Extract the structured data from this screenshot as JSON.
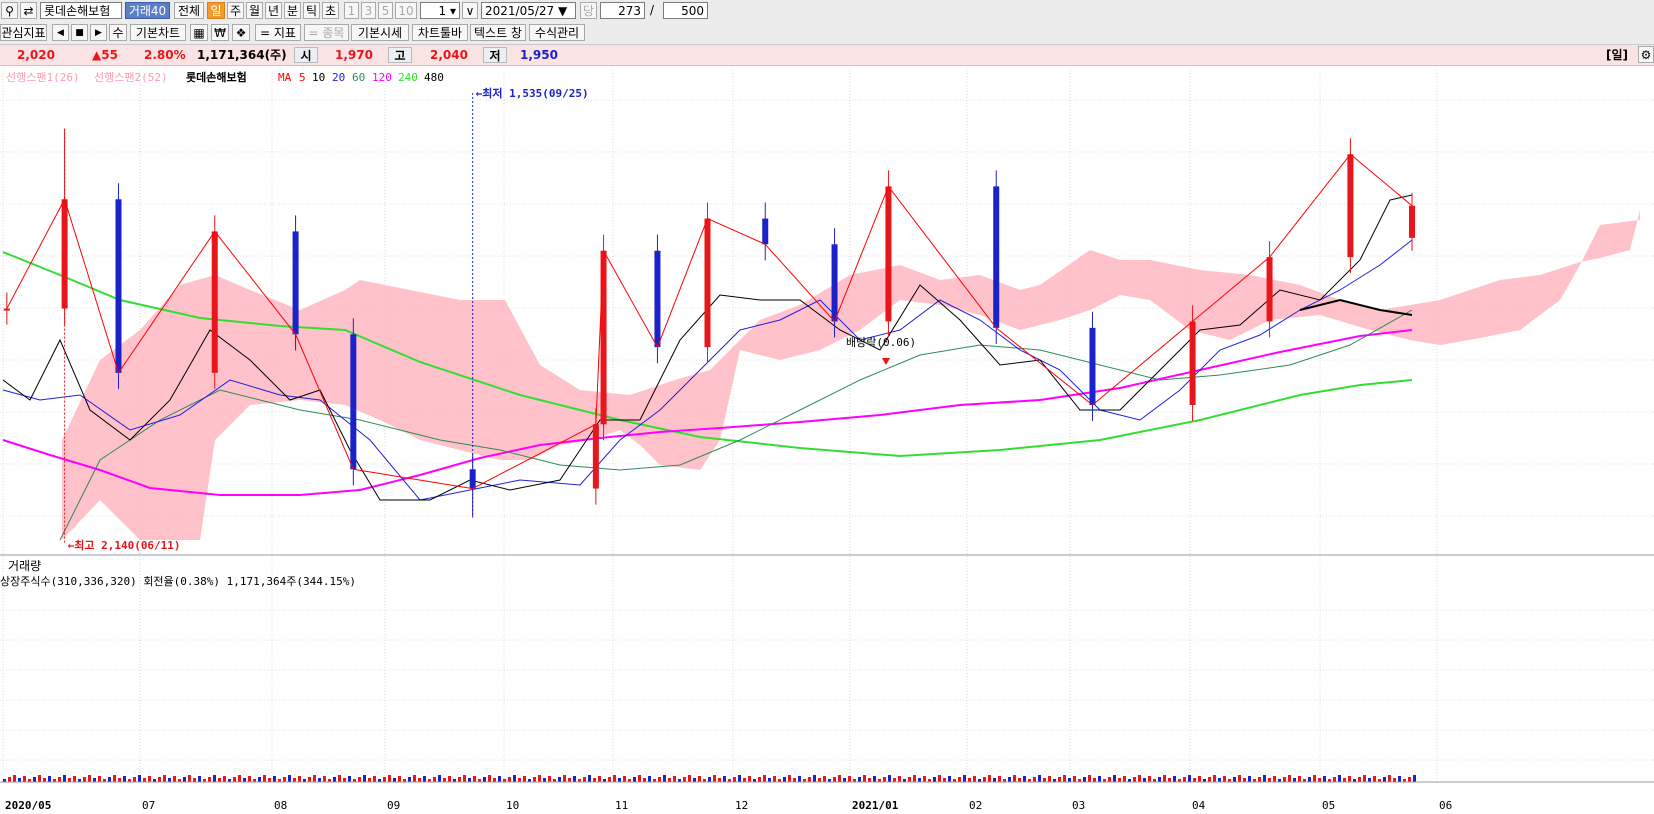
{
  "toolbar": {
    "stock_name": "롯데손해보험",
    "badge": "거래40",
    "periods": [
      "전체",
      "일",
      "주",
      "월",
      "년",
      "분",
      "틱",
      "초"
    ],
    "period_nums": [
      "1",
      "3",
      "5",
      "10"
    ],
    "unit_value": "1",
    "date": "2021/05/27",
    "date_btn": "당",
    "count_value": "273",
    "slash": "/",
    "total_value": "500"
  },
  "toolbar2": {
    "interest_label": "관심지표",
    "prev": "◀",
    "stop": "■",
    "next": "▶",
    "edit": "수",
    "basic_chart": "기본차트",
    "indicator": "지표",
    "item": "종목",
    "basic_quote": "기본시세",
    "chart_toolbar": "차트툴바",
    "text_label": "텍스트 창",
    "formula": "수식관리"
  },
  "quote": {
    "price": "2,020",
    "change": "▲55",
    "rate": "2.80%",
    "volume": "1,171,364(주)",
    "open_label": "시",
    "open": "1,970",
    "high_label": "고",
    "high": "2,040",
    "low_label": "저",
    "low": "1,950",
    "period_tag": "[일]"
  },
  "legend": {
    "span1": "선행스팬1(26)",
    "span2": "선행스팬2(52)",
    "name": "롯데손해보험",
    "ma_label": "MA",
    "periods": [
      "5",
      "10",
      "20",
      "60",
      "120",
      "240",
      "480"
    ],
    "colors": [
      "#ff0000",
      "#000000",
      "#2020e0",
      "#2e8b57",
      "#ff00ff",
      "#33dd33",
      "#000000"
    ]
  },
  "annotations": {
    "low": "최저 1,535(09/25)",
    "high": "최고 2,140(06/11)",
    "dividend": "배당락(0.06)"
  },
  "volume_panel": {
    "title": "거래량",
    "info": "상장주식수(310,336,320) 회전율(0.38%) 1,171,364주(344.15%)"
  },
  "x_axis": {
    "labels": [
      "2020/05",
      "07",
      "08",
      "09",
      "10",
      "11",
      "12",
      "2021/01",
      "02",
      "03",
      "04",
      "05",
      "06"
    ]
  },
  "colors": {
    "up": "#e8151b",
    "down": "#1a22c9",
    "cloud": "#ffb6c1",
    "ma5": "#ff0000",
    "ma10": "#000000",
    "ma20": "#2020e0",
    "ma60": "#2e8b57",
    "ma120": "#ff00ff",
    "ma240": "#33dd33"
  },
  "chart_data": {
    "type": "candlestick",
    "title": "롯데손해보험",
    "period": "daily",
    "x_range": [
      "2020/05",
      "2021/06"
    ],
    "y_range": [
      1500,
      2200
    ],
    "grid": true,
    "points": [
      {
        "date": "2020-05-27",
        "close": 1860
      },
      {
        "date": "2020-06-11",
        "close": 2030,
        "high": 2140
      },
      {
        "date": "2020-06-25",
        "close": 1760
      },
      {
        "date": "2020-07-20",
        "close": 1980
      },
      {
        "date": "2020-08-10",
        "close": 1820
      },
      {
        "date": "2020-08-25",
        "close": 1610
      },
      {
        "date": "2020-09-25",
        "close": 1580,
        "low": 1535
      },
      {
        "date": "2020-10-27",
        "close": 1680
      },
      {
        "date": "2020-10-29",
        "close": 1950
      },
      {
        "date": "2020-11-12",
        "close": 1800
      },
      {
        "date": "2020-11-25",
        "close": 2000
      },
      {
        "date": "2020-12-10",
        "close": 1960
      },
      {
        "date": "2020-12-28",
        "close": 1840
      },
      {
        "date": "2021-01-11",
        "close": 2050
      },
      {
        "date": "2021-02-08",
        "close": 1830
      },
      {
        "date": "2021-03-05",
        "close": 1710
      },
      {
        "date": "2021-03-31",
        "close": 1840
      },
      {
        "date": "2021-04-20",
        "close": 1940
      },
      {
        "date": "2021-05-11",
        "close": 2100
      },
      {
        "date": "2021-05-27",
        "open": 1970,
        "high": 2040,
        "low": 1950,
        "close": 2020
      }
    ]
  }
}
